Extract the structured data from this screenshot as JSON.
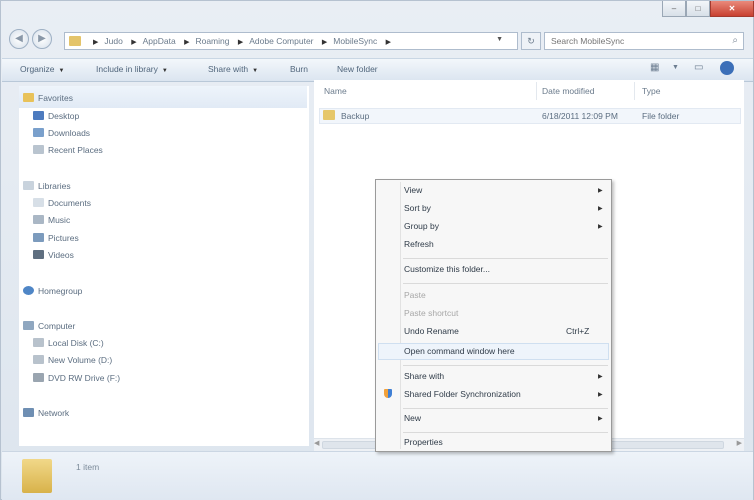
{
  "window": {
    "controls": {
      "minimize": "–",
      "maximize": "□",
      "close": "✕"
    }
  },
  "nav_buttons": {
    "back": "◀",
    "forward": "▶"
  },
  "address": {
    "crumbs": [
      "Judo",
      "AppData",
      "Roaming",
      "Adobe Computer",
      "MobileSync"
    ],
    "dropdown": "▼"
  },
  "refresh": "↻",
  "search": {
    "placeholder": "Search MobileSync",
    "icon": "⌕"
  },
  "toolbar": {
    "organize": "Organize",
    "include_in_library": "Include in library",
    "share_with": "Share with",
    "burn": "Burn",
    "new_folder": "New folder",
    "dropdown_arrow": "▼"
  },
  "navigation": {
    "favorites": {
      "header": "Favorites",
      "items": [
        "Desktop",
        "Downloads",
        "Recent Places"
      ]
    },
    "libraries": {
      "header": "Libraries",
      "items": [
        "Documents",
        "Music",
        "Pictures",
        "Videos"
      ]
    },
    "homegroup": "Homegroup",
    "computer": {
      "header": "Computer",
      "items": [
        "Local Disk (C:)",
        "New Volume (D:)",
        "DVD RW Drive (F:)"
      ]
    },
    "network": "Network"
  },
  "file_list": {
    "columns": {
      "name": "Name",
      "date": "Date modified",
      "type": "Type"
    },
    "rows": [
      {
        "name": "Backup",
        "date": "6/18/2011 12:09 PM",
        "type": "File folder"
      }
    ]
  },
  "status": {
    "count": "1 item"
  },
  "context_menu": {
    "view": "View",
    "sort_by": "Sort by",
    "group_by": "Group by",
    "refresh": "Refresh",
    "customize": "Customize this folder...",
    "paste": "Paste",
    "paste_shortcut": "Paste shortcut",
    "undo_rename": "Undo Rename",
    "undo_shortcut": "Ctrl+Z",
    "open_command": "Open command window here",
    "share_with": "Share with",
    "shared_folder_sync": "Shared Folder Synchronization",
    "new": "New",
    "properties": "Properties",
    "submenu_arrow": "▶"
  },
  "colors": {
    "folder": "#e6c76a",
    "selection": "#eef4fb",
    "close_button": "#c84131"
  }
}
